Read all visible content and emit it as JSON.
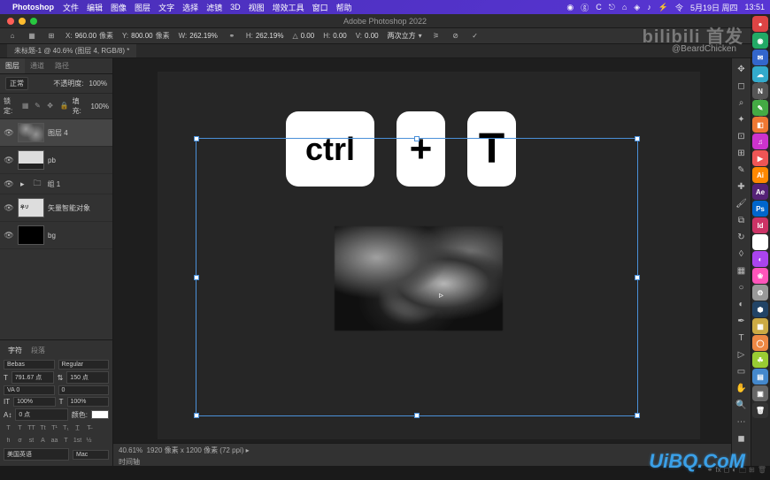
{
  "menubar": {
    "apple": "",
    "app": "Photoshop",
    "items": [
      "文件",
      "编辑",
      "图像",
      "图层",
      "文字",
      "选择",
      "滤镜",
      "3D",
      "视图",
      "增效工具",
      "窗口",
      "帮助"
    ],
    "right": {
      "icons": [
        "◉",
        "ⓖ",
        "C",
        "⎋",
        "⌂",
        "◈",
        "♪",
        "⚡",
        "令"
      ],
      "date": "5月19日 周四",
      "time": "13:51"
    }
  },
  "titlebar": {
    "title": "Adobe Photoshop 2022"
  },
  "optbar": {
    "x_lbl": "X:",
    "x": "960.00",
    "x_unit": "像素",
    "y_lbl": "Y:",
    "y": "800.00",
    "y_unit": "像素",
    "w_lbl": "W:",
    "w": "262.19%",
    "h_lbl": "H:",
    "h": "262.19%",
    "ang_lbl": "△",
    "ang": "0.00",
    "hskew_lbl": "H:",
    "hskew": "0.00",
    "vskew_lbl": "V:",
    "vskew": "0.00",
    "interp": "两次立方"
  },
  "doc_tab": "未标题-1 @ 40.6% (图层 4, RGB/8) *",
  "layers_panel": {
    "tabs": [
      "图层",
      "通道",
      "路径"
    ],
    "mode": "正常",
    "opacity_lbl": "不透明度:",
    "opacity": "100%",
    "lock_lbl": "锁定:",
    "fill_lbl": "填充:",
    "fill": "100%",
    "layers": [
      {
        "name": "图层 4",
        "thumb": "clouds",
        "selected": true
      },
      {
        "name": "pb",
        "thumb": "pb"
      },
      {
        "name": "组 1",
        "thumb": "folder",
        "group": true
      },
      {
        "name": "矢量智能对象",
        "thumb": "smart"
      },
      {
        "name": "bg",
        "thumb": "black"
      }
    ]
  },
  "char_panel": {
    "tabs": [
      "字符",
      "段落"
    ],
    "font": "Bebas",
    "weight": "Regular",
    "size": "791.67 点",
    "leading": "150 点",
    "va": "VA 0",
    "tracking": "0",
    "scale_v": "100%",
    "scale_h": "100%",
    "baseline": "0 点",
    "color_lbl": "颜色:",
    "lang": "美国英语",
    "aa": "Mac"
  },
  "keys": {
    "ctrl": "ctrl",
    "plus": "+",
    "t": "T"
  },
  "status": {
    "zoom": "40.61%",
    "doc": "1920 像素 x 1200 像素 (72 ppi)",
    "timeline": "时间轴"
  },
  "watermark": {
    "logo": "bilibili 首发",
    "author": "@BeardChicken",
    "uibq": "UiBQ.CoM"
  },
  "dock": [
    {
      "bg": "#d44",
      "t": "●"
    },
    {
      "bg": "#2a6",
      "t": "◉"
    },
    {
      "bg": "#36c",
      "t": "✉"
    },
    {
      "bg": "#3ac",
      "t": "☁"
    },
    {
      "bg": "#555",
      "t": "N"
    },
    {
      "bg": "#4a4",
      "t": "✎"
    },
    {
      "bg": "#e73",
      "t": "◧"
    },
    {
      "bg": "#c3c",
      "t": "♫"
    },
    {
      "bg": "#e55",
      "t": "▶"
    },
    {
      "bg": "#f80",
      "t": "Ai"
    },
    {
      "bg": "#527",
      "t": "Ae"
    },
    {
      "bg": "#06c",
      "t": "Ps"
    },
    {
      "bg": "#c36",
      "t": "Id"
    },
    {
      "bg": "#fff",
      "t": "⌾"
    },
    {
      "bg": "#a4e",
      "t": "◐"
    },
    {
      "bg": "#f5b",
      "t": "❀"
    },
    {
      "bg": "#999",
      "t": "⚙"
    },
    {
      "bg": "#246",
      "t": "⬢"
    },
    {
      "bg": "#ca4",
      "t": "▦"
    },
    {
      "bg": "#e84",
      "t": "◯"
    },
    {
      "bg": "#9c3",
      "t": "☘"
    },
    {
      "bg": "#48c",
      "t": "▤"
    },
    {
      "bg": "#666",
      "t": "▣"
    },
    {
      "bg": "#333",
      "t": "🗑"
    }
  ]
}
